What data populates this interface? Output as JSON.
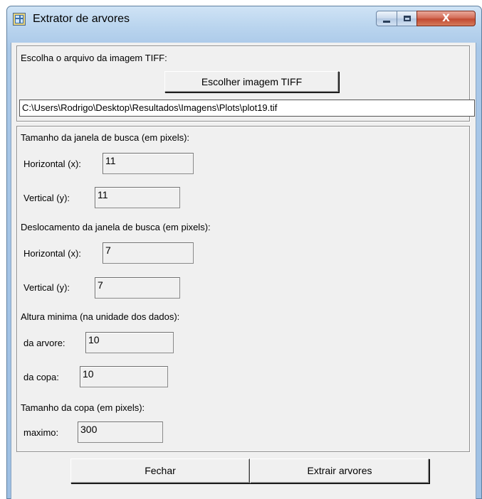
{
  "window": {
    "title": "Extrator de arvores",
    "close_glyph": "X"
  },
  "file": {
    "prompt": "Escolha o arquivo da imagem TIFF:",
    "choose_button": "Escolher imagem TIFF",
    "path": "C:\\Users\\Rodrigo\\Desktop\\Resultados\\Imagens\\Plots\\plot19.tif"
  },
  "window_size": {
    "heading": "Tamanho da janela de busca (em pixels):",
    "horizontal_label": "Horizontal (x):",
    "horizontal_value": "11",
    "vertical_label": "Vertical (y):",
    "vertical_value": "11"
  },
  "window_shift": {
    "heading": "Deslocamento da janela de busca (em pixels):",
    "horizontal_label": "Horizontal (x):",
    "horizontal_value": "7",
    "vertical_label": "Vertical (y):",
    "vertical_value": "7"
  },
  "min_height": {
    "heading": "Altura minima (na unidade dos dados):",
    "tree_label": "da arvore:",
    "tree_value": "10",
    "crown_label": "da copa:",
    "crown_value": "10"
  },
  "crown_size": {
    "heading": "Tamanho da copa (em pixels):",
    "max_label": "maximo:",
    "max_value": "300"
  },
  "footer": {
    "close_button": "Fechar",
    "extract_button": "Extrair arvores"
  }
}
